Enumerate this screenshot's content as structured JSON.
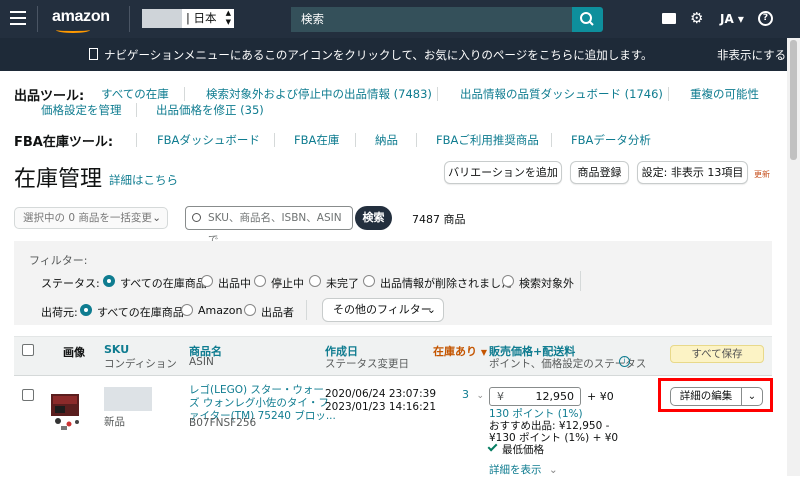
{
  "topbar": {
    "logo": "amazon",
    "locale": "| 日本",
    "search_placeholder": "検索",
    "lang": "JA ▾"
  },
  "navbar": {
    "message": "ナビゲーションメニューにあるこのアイコンをクリックして、お気に入りのページをこちらに追加します。",
    "hide": "非表示にする"
  },
  "listing_tools": {
    "label": "出品ツール:",
    "links": [
      "すべての在庫",
      "検索対象外および停止中の出品情報 (7483)",
      "出品情報の品質ダッシュボード (1746)",
      "重複の可能性",
      "価格設定を管理",
      "出品価格を修正 (35)"
    ]
  },
  "fba_tools": {
    "label": "FBA在庫ツール:",
    "links": [
      "FBAダッシュボード",
      "FBA在庫",
      "納品",
      "FBAご利用推奨商品",
      "FBAデータ分析"
    ]
  },
  "header": {
    "title": "在庫管理",
    "details_link": "詳細はこちら",
    "add_variation": "バリエーションを追加",
    "register_product": "商品登録",
    "settings": "設定: 非表示 13項目",
    "update": "更新"
  },
  "search": {
    "bulk_action": "選択中の 0 商品を一括変更",
    "placeholder": "SKU、商品名、ISBN、ASINで",
    "button": "検索",
    "count": "7487 商品"
  },
  "filters": {
    "label": "フィルター:",
    "status_label": "ステータス:",
    "status_options": [
      "すべての在庫商品",
      "出品中",
      "停止中",
      "未完了",
      "出品情報が削除されました",
      "検索対象外"
    ],
    "status_selected": 0,
    "fulfillment_label": "出荷元:",
    "fulfillment_options": [
      "すべての在庫商品",
      "Amazon",
      "出品者"
    ],
    "fulfillment_selected": 0,
    "other": "その他のフィルター"
  },
  "table": {
    "headers": {
      "image": "画像",
      "sku": "SKU",
      "condition": "コンディション",
      "product_name": "商品名",
      "asin": "ASIN",
      "created": "作成日",
      "status_changed": "ステータス変更日",
      "in_stock": "在庫あり",
      "price": "販売価格+配送料",
      "price_sub": "ポイント、価格設定のステータス",
      "save_all": "すべて保存"
    },
    "rows": [
      {
        "condition": "新品",
        "product_name_lines": [
          "レゴ(LEGO) スター・ウォー",
          "ズ ウォンレグ小佐のタイ・フ",
          "ァイター(TM) 75240 ブロッ..."
        ],
        "asin": "B07FNSF256",
        "created": "2020/06/24 23:07:39",
        "status_changed": "2023/01/23 14:16:21",
        "in_stock": "3",
        "price_yen": "¥",
        "price": "12,950",
        "shipping": "+ ¥0",
        "points": "130 ポイント (1%)",
        "recommended_1": "おすすめ出品: ¥12,950 -",
        "recommended_2": "¥130 ポイント (1%) + ¥0",
        "lowest": "最低価格",
        "show_details": "詳細を表示",
        "edit": "詳細の編集"
      }
    ]
  }
}
